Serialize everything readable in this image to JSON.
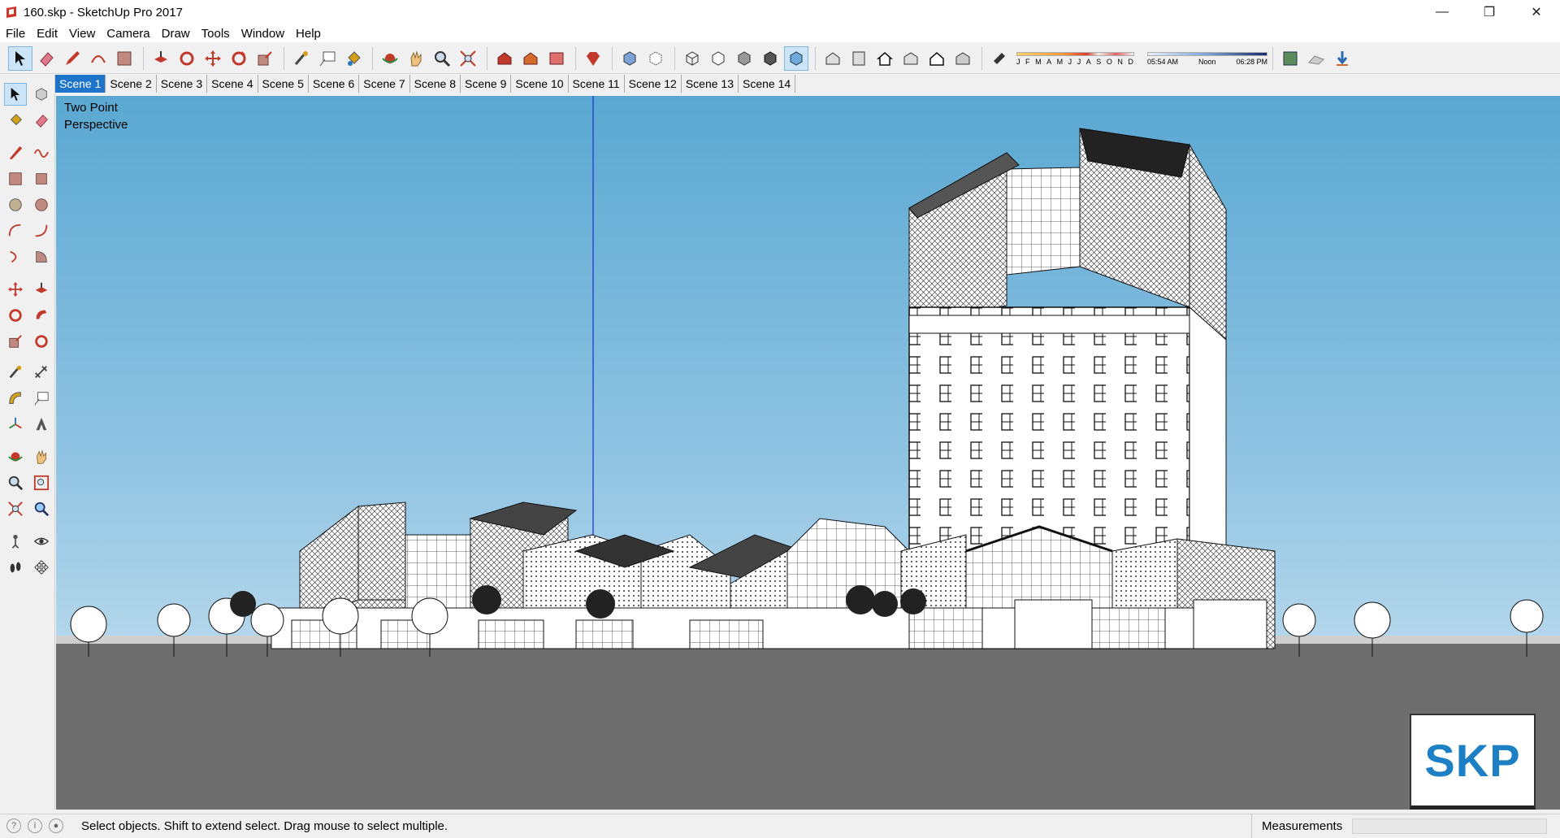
{
  "window": {
    "title": "160.skp - SketchUp Pro 2017",
    "minimize": "—",
    "restore": "❐",
    "close": "✕"
  },
  "menu": [
    "File",
    "Edit",
    "View",
    "Camera",
    "Draw",
    "Tools",
    "Window",
    "Help"
  ],
  "shadow": {
    "months": [
      "J",
      "F",
      "M",
      "A",
      "M",
      "J",
      "J",
      "A",
      "S",
      "O",
      "N",
      "D"
    ],
    "time_start": "05:54 AM",
    "time_mid": "Noon",
    "time_end": "06:28 PM"
  },
  "scenes": [
    "Scene 1",
    "Scene 2",
    "Scene 3",
    "Scene 4",
    "Scene 5",
    "Scene 6",
    "Scene 7",
    "Scene 8",
    "Scene 9",
    "Scene 10",
    "Scene 11",
    "Scene 12",
    "Scene 13",
    "Scene 14"
  ],
  "active_scene": "Scene 1",
  "viewport": {
    "label_line1": "Two Point",
    "label_line2": "Perspective",
    "logo": "SKP"
  },
  "status": {
    "hint": "Select objects. Shift to extend select. Drag mouse to select multiple.",
    "measurements_label": "Measurements",
    "measurements_value": ""
  },
  "colors": {
    "accent": "#1e74c8",
    "sky_top": "#5aa8d2",
    "sky_bottom": "#d8eaf3",
    "logo_text": "#1d7fc4",
    "icon_red": "#c0392b"
  }
}
